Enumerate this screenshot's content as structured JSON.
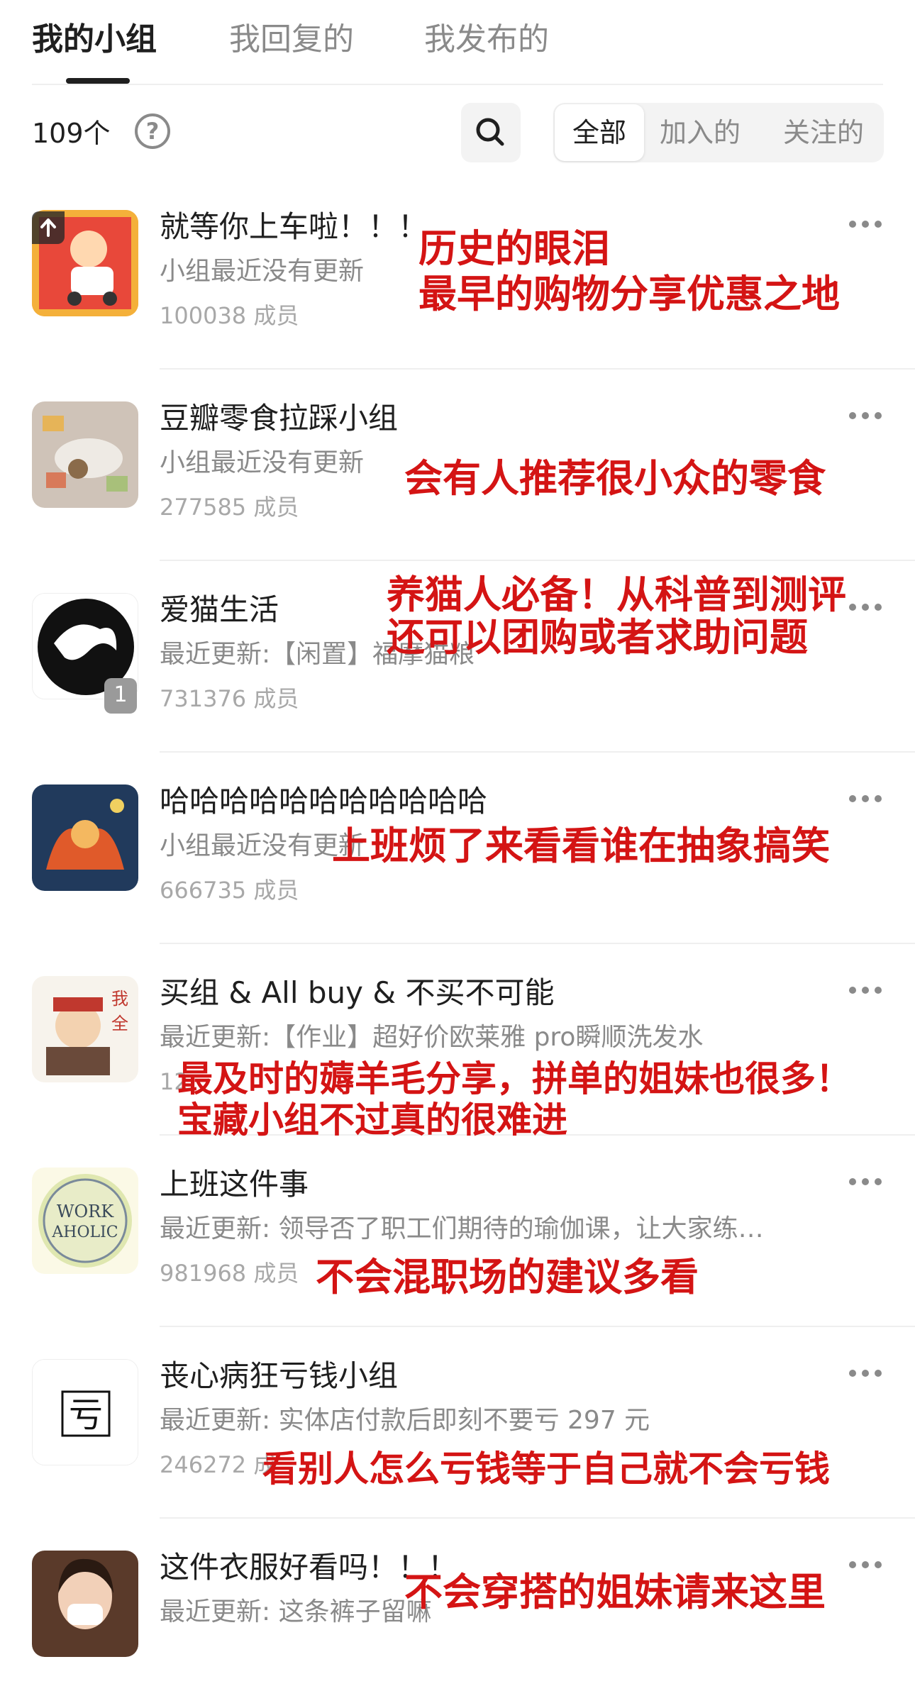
{
  "tabs": [
    {
      "label": "我的小组",
      "active": true
    },
    {
      "label": "我回复的",
      "active": false
    },
    {
      "label": "我发布的",
      "active": false
    }
  ],
  "toolbar": {
    "count": "109个",
    "help": "?",
    "segments": [
      "全部",
      "加入的",
      "关注的"
    ],
    "active_segment": "全部"
  },
  "groups": [
    {
      "name": "就等你上车啦！！！",
      "update": "小组最近没有更新",
      "members": "100038 成员",
      "note": [
        "历史的眼泪",
        "最早的购物分享优惠之地"
      ]
    },
    {
      "name": "豆瓣零食拉踩小组",
      "update": "小组最近没有更新",
      "members": "277585 成员",
      "note": [
        "会有人推荐很小众的零食"
      ]
    },
    {
      "name": "爱猫生活",
      "update": "最近更新:【闲置】福摩猫粮",
      "members": "731376 成员",
      "badge": "1",
      "note": [
        "养猫人必备！从科普到测评",
        "还可以团购或者求助问题"
      ]
    },
    {
      "name": "哈哈哈哈哈哈哈哈哈哈哈",
      "update": "小组最近没有更新",
      "members": "666735 成员",
      "note": [
        "上班烦了来看看谁在抽象搞笑"
      ]
    },
    {
      "name": "买组 & All buy & 不买不可能",
      "update": "最近更新:【作业】超好价欧莱雅 pro瞬顺洗发水",
      "members": "12",
      "note": [
        "最及时的薅羊毛分享，拼单的姐妹也很多！",
        "宝藏小组不过真的很难进"
      ]
    },
    {
      "name": "上班这件事",
      "update": "最近更新: 领导否了职工们期待的瑜伽课，让大家练…",
      "members": "981968 成员",
      "note": [
        "不会混职场的建议多看"
      ]
    },
    {
      "name": "丧心病狂亏钱小组",
      "update": "最近更新: 实体店付款后即刻不要亏 297 元",
      "members": "246272 成",
      "note": [
        "看别人怎么亏钱等于自己就不会亏钱"
      ]
    },
    {
      "name": "这件衣服好看吗！！！",
      "update": "最近更新: 这条裤子留嘛",
      "members": "",
      "note": [
        "不会穿搭的姐妹请来这里"
      ]
    }
  ],
  "icons": [
    "search-icon",
    "help-icon",
    "more-icon",
    "pin-icon"
  ],
  "colors": {
    "annotation": "#d41414",
    "text": "#1f1f1f",
    "muted": "#8a8a8a"
  }
}
